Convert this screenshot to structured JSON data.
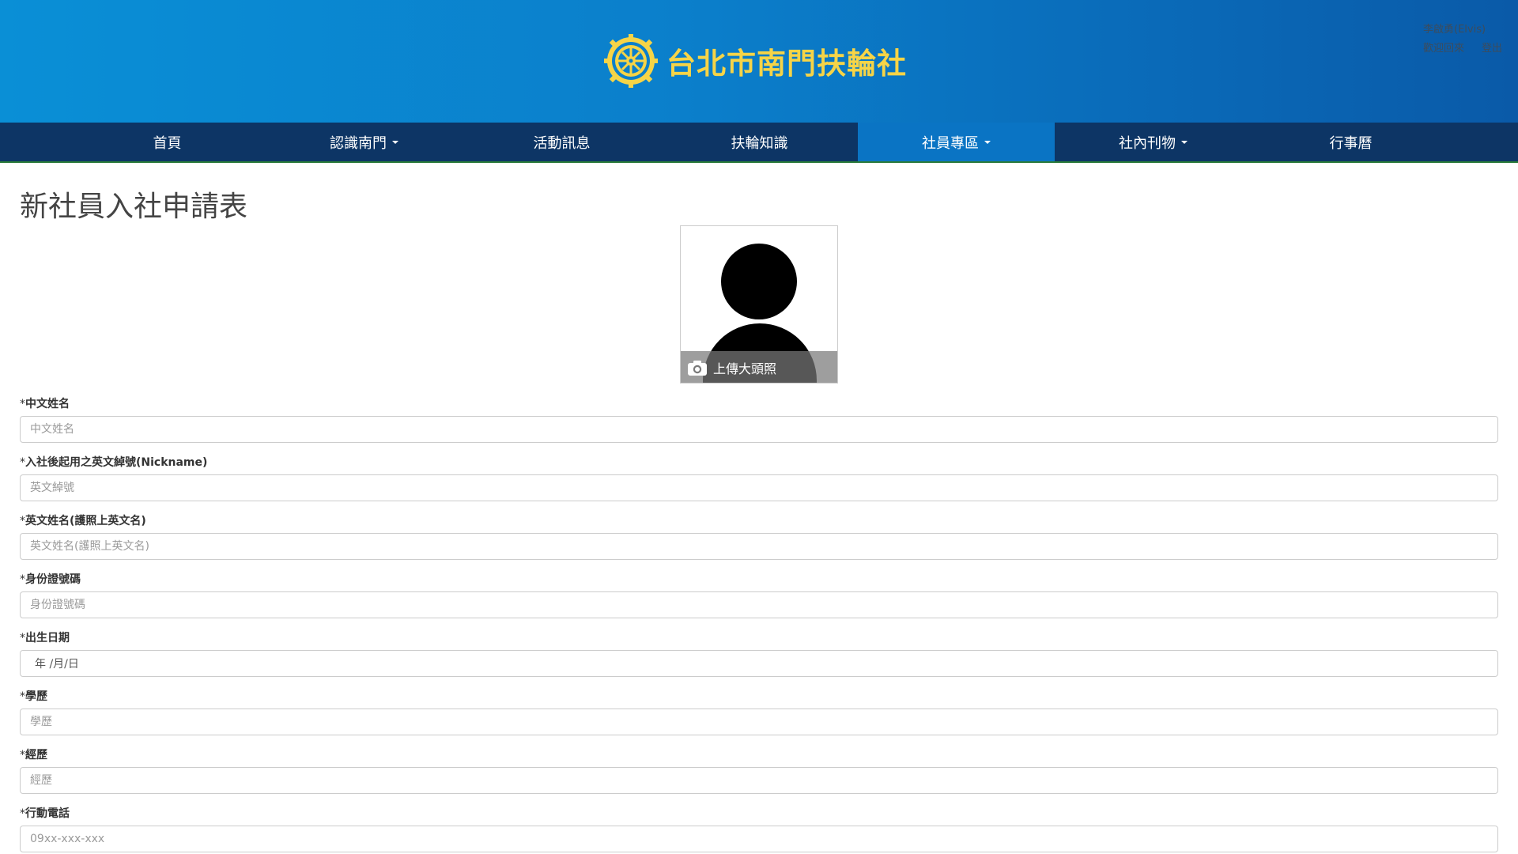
{
  "header": {
    "title": "台北市南門扶輪社",
    "logo_icon": "rotary-wheel-icon",
    "user_name": "李啟勇(Elvis)",
    "welcome": "歡迎回來",
    "logout": "登出"
  },
  "nav": {
    "items": [
      {
        "label": "首頁",
        "dropdown": false
      },
      {
        "label": "認識南門",
        "dropdown": true
      },
      {
        "label": "活動訊息",
        "dropdown": false
      },
      {
        "label": "扶輪知識",
        "dropdown": false
      },
      {
        "label": "社員專區",
        "dropdown": true,
        "active": true
      },
      {
        "label": "社內刊物",
        "dropdown": true
      },
      {
        "label": "行事曆",
        "dropdown": false
      }
    ]
  },
  "page": {
    "title": "新社員入社申請表",
    "upload_photo": "上傳大頭照",
    "upload_icon": "camera-icon"
  },
  "form": {
    "fields": [
      {
        "label": "中文姓名",
        "placeholder": "中文姓名"
      },
      {
        "label": "入社後起用之英文綽號(Nickname)",
        "placeholder": "英文綽號"
      },
      {
        "label": "英文姓名(護照上英文名)",
        "placeholder": "英文姓名(護照上英文名)"
      },
      {
        "label": "身份證號碼",
        "placeholder": "身份證號碼"
      },
      {
        "label": "出生日期",
        "placeholder": "年 /月/日"
      },
      {
        "label": "學歷",
        "placeholder": "學歷"
      },
      {
        "label": "經歷",
        "placeholder": "經歷"
      },
      {
        "label": "行動電話",
        "placeholder": "09xx-xxx-xxx"
      }
    ],
    "required_mark": "*"
  },
  "colors": {
    "header_blue": "#0b7fcb",
    "nav_navy": "#0d3565",
    "nav_active": "#0a74c4",
    "logo_gold": "#f6d447"
  }
}
